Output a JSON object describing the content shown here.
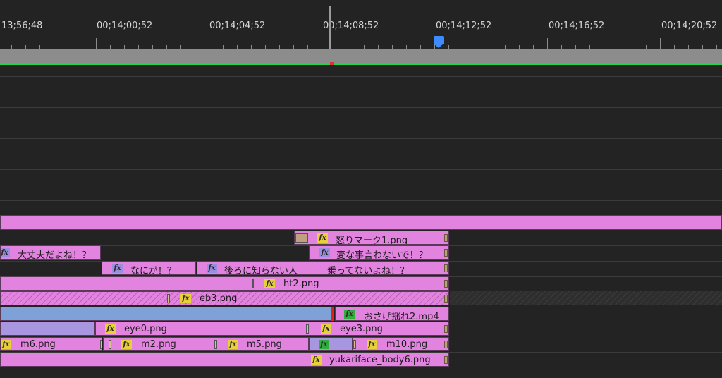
{
  "ruler": {
    "timecodes": [
      "13;56;48",
      "00;14;00;52",
      "00;14;04;52",
      "00;14;08;52",
      "00;14;12;52",
      "00;14;16;52",
      "00;14;20;52"
    ]
  },
  "clips": {
    "anger_mark": "怒りマーク1.png",
    "daijoubu": "大丈夫だよね！？",
    "hen_na": "変な事言わないで！？",
    "nanika": "なにが！？",
    "ushiro": "後ろに知らない人",
    "notte": "乗ってないよね！？",
    "ht2": "ht2.png",
    "eb3": "eb3.png",
    "osage": "おさげ揺れ2.mp4",
    "eye0": "eye0.png",
    "eye3": "eye3.png",
    "m6": "m6.png",
    "m2": "m2.png",
    "m5": "m5.png",
    "m10": "m10.png",
    "body": "yukariface_body6.png"
  },
  "fx_label": "fx",
  "colors": {
    "clip_pink": "#e283e0",
    "clip_blue": "#7ea2d8",
    "playhead": "#3c8cff",
    "workarea_line": "#21d44a"
  }
}
